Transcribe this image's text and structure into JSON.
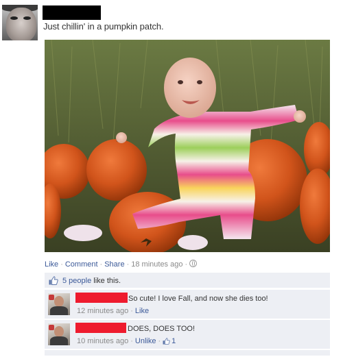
{
  "post": {
    "status_text": "Just chillin' in a pumpkin patch.",
    "actions": {
      "like": "Like",
      "comment": "Comment",
      "share": "Share",
      "timestamp": "18 minutes ago"
    }
  },
  "likes": {
    "count_link": "5 people",
    "suffix": " like this."
  },
  "comments": [
    {
      "text": "So cute! I love Fall, and now she dies too!",
      "time": "12 minutes ago",
      "action": "Like"
    },
    {
      "text": "DOES, DOES TOO!",
      "time": "10 minutes ago",
      "action": "Unlike",
      "like_count": "1"
    }
  ],
  "colors": {
    "link": "#3b5998",
    "panel_bg": "#edeff4",
    "redaction_name": "#000000",
    "redaction_commenter": "#ee1b2e"
  }
}
